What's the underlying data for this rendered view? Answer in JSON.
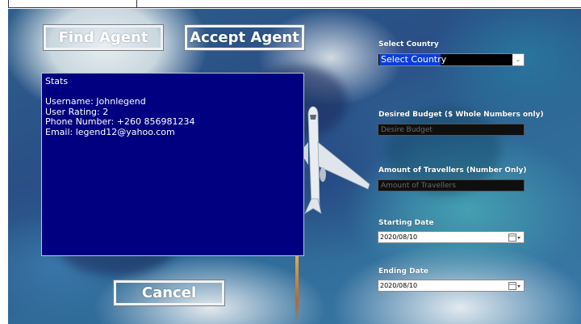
{
  "buttons": {
    "find_agent": "Find Agent",
    "accept_agent": "Accept Agent",
    "cancel": "Cancel"
  },
  "stats": {
    "heading": "Stats",
    "username": "Username: Johnlegend",
    "rating": "User Rating: 2",
    "phone": "Phone Number: +260 856981234",
    "email": "Email: legend12@yahoo.com"
  },
  "form": {
    "country_label": "Select Country",
    "country_value": "Select Country",
    "budget_label": "Desired Budget ($ Whole Numbers only)",
    "budget_placeholder": "Desire Budget",
    "travellers_label": "Amount of Travellers (Number Only)",
    "travellers_placeholder": "Amount of Travellers",
    "start_label": "Starting Date",
    "start_value": "2020/08/10",
    "end_label": "Ending Date",
    "end_value": "2020/08/10"
  },
  "colors": {
    "stats_bg": "#000080",
    "select_highlight": "#0a3fd6"
  }
}
